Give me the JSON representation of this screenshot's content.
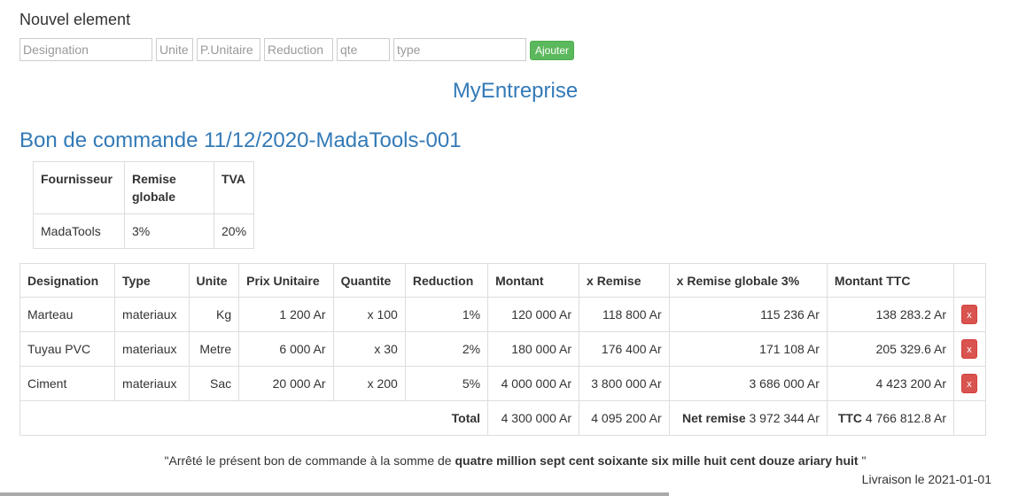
{
  "form": {
    "heading": "Nouvel element",
    "placeholders": {
      "designation": "Designation",
      "unite": "Unite",
      "prix_unitaire": "P.Unitaire",
      "reduction": "Reduction",
      "qte": "qte",
      "type": "type"
    },
    "add_label": "Ajouter"
  },
  "company_name": "MyEntreprise",
  "order_title": "Bon de commande 11/12/2020-MadaTools-001",
  "supplier_table": {
    "headers": [
      "Fournisseur",
      "Remise globale",
      "TVA"
    ],
    "row": [
      "MadaTools",
      "3%",
      "20%"
    ]
  },
  "items_table": {
    "headers": [
      "Designation",
      "Type",
      "Unite",
      "Prix Unitaire",
      "Quantite",
      "Reduction",
      "Montant",
      "x Remise",
      "x Remise globale 3%",
      "Montant TTC"
    ],
    "rows": [
      [
        "Marteau",
        "materiaux",
        "Kg",
        "1 200 Ar",
        "x 100",
        "1%",
        "120 000 Ar",
        "118 800 Ar",
        "115 236 Ar",
        "138 283.2 Ar"
      ],
      [
        "Tuyau PVC",
        "materiaux",
        "Metre",
        "6 000 Ar",
        "x 30",
        "2%",
        "180 000 Ar",
        "176 400 Ar",
        "171 108 Ar",
        "205 329.6 Ar"
      ],
      [
        "Ciment",
        "materiaux",
        "Sac",
        "20 000 Ar",
        "x 200",
        "5%",
        "4 000 000 Ar",
        "3 800 000 Ar",
        "3 686 000 Ar",
        "4 423 200 Ar"
      ]
    ],
    "delete_label": "x",
    "totals": {
      "label": "Total",
      "montant": "4 300 000 Ar",
      "remise": "4 095 200 Ar",
      "net_remise_label": "Net remise",
      "net_remise_value": "3 972 344 Ar",
      "ttc_label": "TTC",
      "ttc_value": "4 766 812.8 Ar"
    }
  },
  "footer": {
    "prefix": "\"Arrêté le présent bon de commande à la somme de ",
    "amount_words": "quatre million sept cent soixante six mille huit cent douze ariary huit",
    "suffix": " \"",
    "delivery": "Livraison le 2021-01-01"
  },
  "colors": {
    "link_blue": "#337ab7",
    "success_green": "#5cb85c",
    "danger_red": "#d9534f"
  }
}
